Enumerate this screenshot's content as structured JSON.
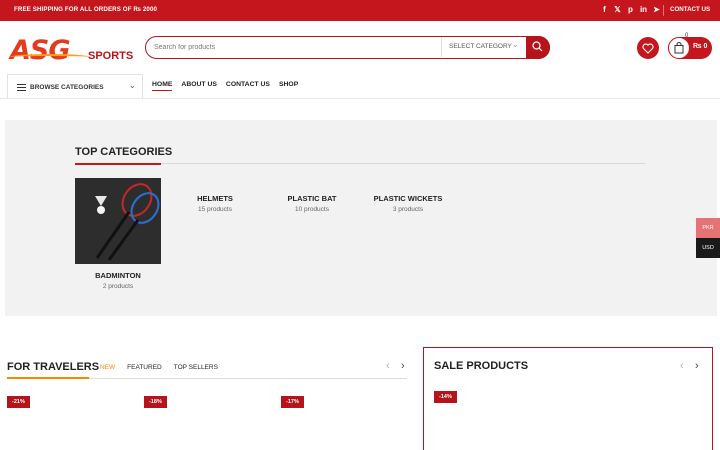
{
  "topbar": {
    "shipping": "FREE SHIPPING FOR ALL ORDERS OF ₨ 2000",
    "socials": [
      "facebook-icon",
      "x-icon",
      "pinterest-icon",
      "linkedin-icon",
      "telegram-icon"
    ],
    "social_glyphs": [
      "f",
      "𝕏",
      "p",
      "in",
      "➤"
    ],
    "contact": "CONTACT US"
  },
  "logo": {
    "main": "ASG",
    "sub": "SPORTS"
  },
  "search": {
    "placeholder": "Search for products",
    "category": "SELECT CATEGORY"
  },
  "cart": {
    "amount": "₨ 0",
    "count": "0"
  },
  "browse": {
    "label": "BROWSE CATEGORIES"
  },
  "nav": {
    "items": [
      "HOME",
      "ABOUT US",
      "CONTACT US",
      "SHOP"
    ]
  },
  "top_categories": {
    "title": "TOP CATEGORIES",
    "items": [
      {
        "name": "BADMINTON",
        "count": "2 products"
      },
      {
        "name": "HELMETS",
        "count": "15 products"
      },
      {
        "name": "PLASTIC BAT",
        "count": "10 products"
      },
      {
        "name": "PLASTIC WICKETS",
        "count": "3 products"
      }
    ]
  },
  "currency": {
    "pkr": "PKR",
    "usd": "USD"
  },
  "travelers": {
    "title": "FOR TRAVELERS",
    "tabs": [
      "NEW",
      "FEATURED",
      "TOP SELLERS"
    ],
    "discounts": [
      "-21%",
      "-18%",
      "-17%"
    ]
  },
  "sale": {
    "title": "SALE PRODUCTS",
    "discount": "-14%"
  },
  "colors": {
    "brand": "#c4161c",
    "accent": "#f08c00"
  }
}
